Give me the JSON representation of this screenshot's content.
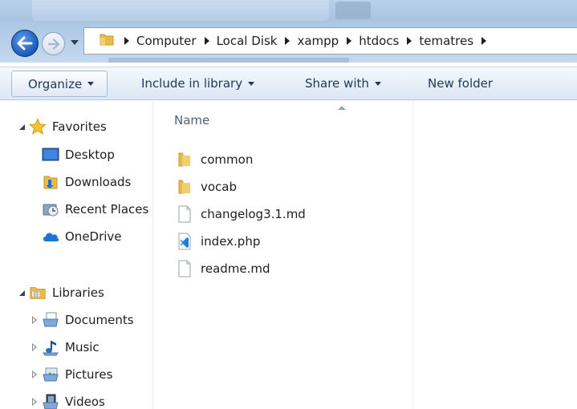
{
  "address_bar": {
    "crumbs": [
      "Computer",
      "Local Disk",
      "xampp",
      "htdocs",
      "tematres"
    ]
  },
  "toolbar": {
    "organize_label": "Organize",
    "include_label": "Include in library",
    "share_label": "Share with",
    "new_folder_label": "New folder"
  },
  "sidebar": {
    "favorites": {
      "label": "Favorites",
      "items": [
        {
          "label": "Desktop",
          "icon": "desktop-icon"
        },
        {
          "label": "Downloads",
          "icon": "downloads-icon"
        },
        {
          "label": "Recent Places",
          "icon": "recent-places-icon"
        },
        {
          "label": "OneDrive",
          "icon": "onedrive-icon"
        }
      ]
    },
    "libraries": {
      "label": "Libraries",
      "items": [
        {
          "label": "Documents",
          "icon": "documents-icon"
        },
        {
          "label": "Music",
          "icon": "music-icon"
        },
        {
          "label": "Pictures",
          "icon": "pictures-icon"
        },
        {
          "label": "Videos",
          "icon": "videos-icon"
        }
      ]
    }
  },
  "content": {
    "column_name": "Name",
    "files": [
      {
        "name": "common",
        "icon": "folder-icon"
      },
      {
        "name": "vocab",
        "icon": "folder-icon"
      },
      {
        "name": "changelog3.1.md",
        "icon": "file-icon"
      },
      {
        "name": "index.php",
        "icon": "vscode-file-icon"
      },
      {
        "name": "readme.md",
        "icon": "file-icon"
      }
    ]
  },
  "colors": {
    "title_bar": "#b9d1ea",
    "toolbar": "#e6eef8",
    "toolbar_text": "#1e395b",
    "folder": "#e8bb4a",
    "back_button": "#1f5fc0"
  }
}
